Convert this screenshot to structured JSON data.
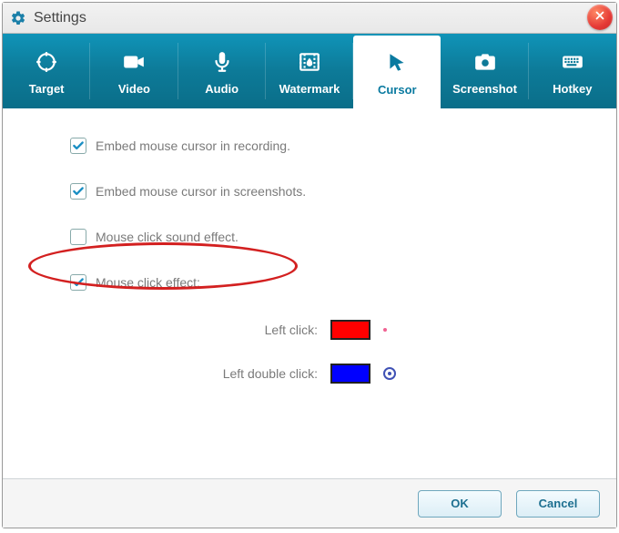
{
  "window": {
    "title": "Settings"
  },
  "tabs": {
    "target": "Target",
    "video": "Video",
    "audio": "Audio",
    "watermark": "Watermark",
    "cursor": "Cursor",
    "screenshot": "Screenshot",
    "hotkey": "Hotkey",
    "selected": "cursor"
  },
  "cursor": {
    "embed_recording": {
      "checked": true,
      "label": "Embed mouse cursor in recording."
    },
    "embed_screenshot": {
      "checked": true,
      "label": "Embed mouse cursor in screenshots."
    },
    "click_sound": {
      "checked": false,
      "label": "Mouse click sound effect."
    },
    "click_effect": {
      "checked": true,
      "label": "Mouse click effect:"
    },
    "left_click": {
      "label": "Left click:",
      "color": "#ff0000"
    },
    "left_double_click": {
      "label": "Left double click:",
      "color": "#0000ff"
    }
  },
  "footer": {
    "ok": "OK",
    "cancel": "Cancel"
  }
}
